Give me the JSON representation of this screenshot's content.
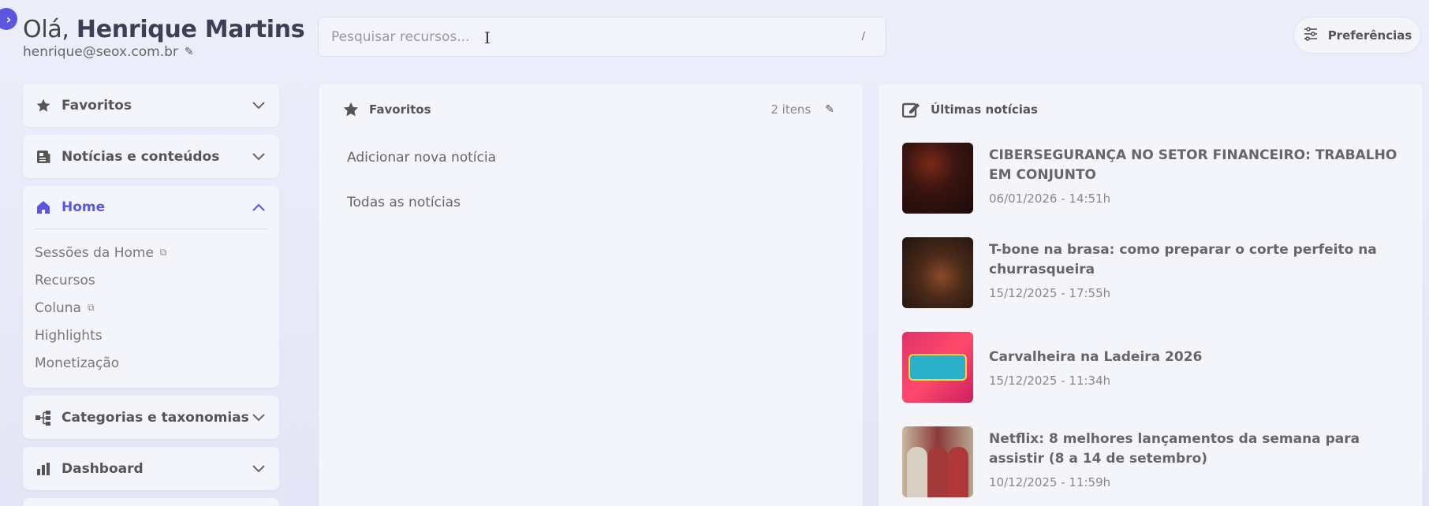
{
  "header": {
    "greeting_prefix": "Olá,",
    "user_name": "Henrique Martins",
    "email": "henrique@seox.com.br"
  },
  "search": {
    "placeholder": "Pesquisar recursos...",
    "shortcut": "/"
  },
  "preferences": {
    "label": "Preferências"
  },
  "sidebar": {
    "sections": [
      {
        "label": "Favoritos",
        "icon": "star-icon"
      },
      {
        "label": "Notícias e conteúdos",
        "icon": "newspaper-icon"
      },
      {
        "label": "Home",
        "icon": "home-icon",
        "expanded": true,
        "items": [
          {
            "label": "Sessões da Home",
            "external": true
          },
          {
            "label": "Recursos"
          },
          {
            "label": "Coluna",
            "external": true
          },
          {
            "label": "Highlights"
          },
          {
            "label": "Monetização"
          }
        ]
      },
      {
        "label": "Categorias e taxonomias",
        "icon": "sitemap-icon"
      },
      {
        "label": "Dashboard",
        "icon": "bar-chart-icon"
      }
    ]
  },
  "favorites_panel": {
    "title": "Favoritos",
    "count": "2 itens",
    "links": [
      "Adicionar nova notícia",
      "Todas as notícias"
    ]
  },
  "news_panel": {
    "title": "Últimas notícias",
    "items": [
      {
        "title": "CIBERSEGURANÇA NO SETOR FINANCEIRO: TRABALHO EM CONJUNTO",
        "date": "06/01/2026 - 14:51h"
      },
      {
        "title": "T-bone na brasa: como preparar o corte perfeito na churrasqueira",
        "date": "15/12/2025 - 17:55h"
      },
      {
        "title": "Carvalheira na Ladeira 2026",
        "date": "15/12/2025 - 11:34h"
      },
      {
        "title": "Netflix: 8 melhores lançamentos da semana para assistir (8 a 14 de setembro)",
        "date": "10/12/2025 - 11:59h"
      }
    ]
  },
  "colors": {
    "accent": "#5b55e0",
    "panel_bg": "#f4f5fb",
    "page_bg": "#e8eaf8"
  }
}
